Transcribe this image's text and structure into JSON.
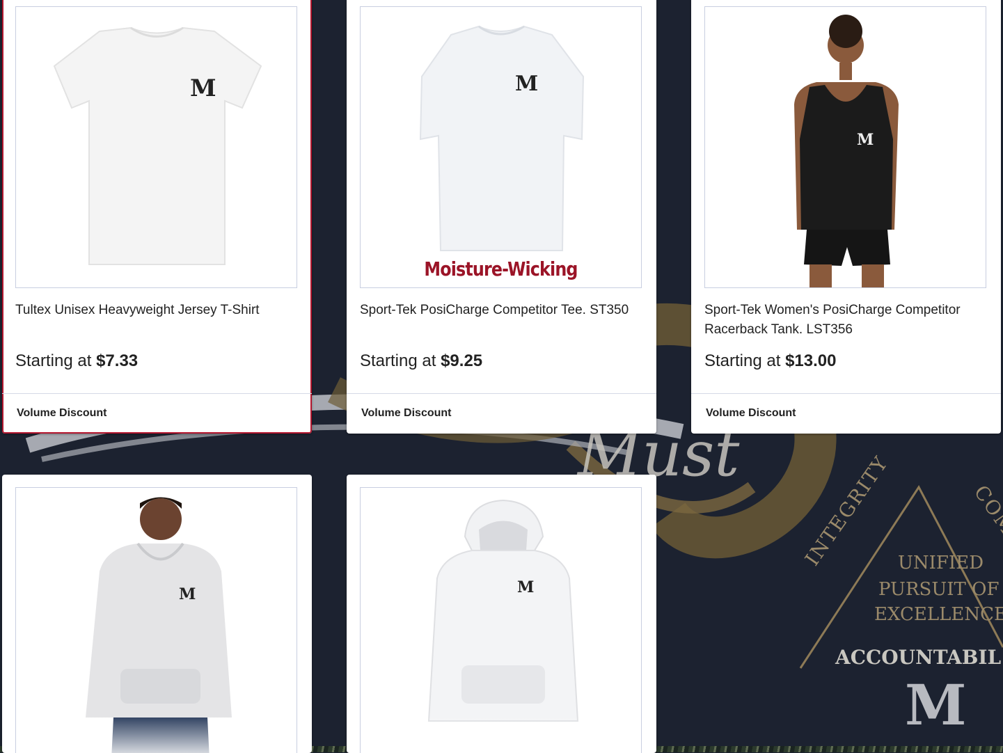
{
  "products": [
    {
      "title": "Tultex Unisex Heavyweight Jersey T-Shirt",
      "price_prefix": "Starting at",
      "price": "$7.33",
      "discount": "Volume Discount"
    },
    {
      "title": "Sport-Tek PosiCharge Competitor Tee. ST350",
      "price_prefix": "Starting at",
      "price": "$9.25",
      "discount": "Volume Discount",
      "image_caption": "Moisture-Wicking"
    },
    {
      "title": "Sport-Tek Women's PosiCharge Competitor Racerback Tank. LST356",
      "price_prefix": "Starting at",
      "price": "$13.00",
      "discount": "Volume Discount"
    },
    {
      "title": "",
      "price_prefix": "",
      "price": "",
      "discount": ""
    },
    {
      "title": "",
      "price_prefix": "",
      "price": "",
      "discount": ""
    }
  ],
  "background": {
    "script_word": "Must",
    "seal_words": [
      "INTEGRITY",
      "COMP",
      "UNIFIED",
      "PURSUIT OF",
      "EXCELLENCE",
      "ACCOUNTABIL"
    ]
  },
  "logo_letter": "M",
  "colors": {
    "selected_border": "#b3162e",
    "caption_red": "#9b1427",
    "page_bg": "#1c2230",
    "gold": "#8a7040"
  }
}
